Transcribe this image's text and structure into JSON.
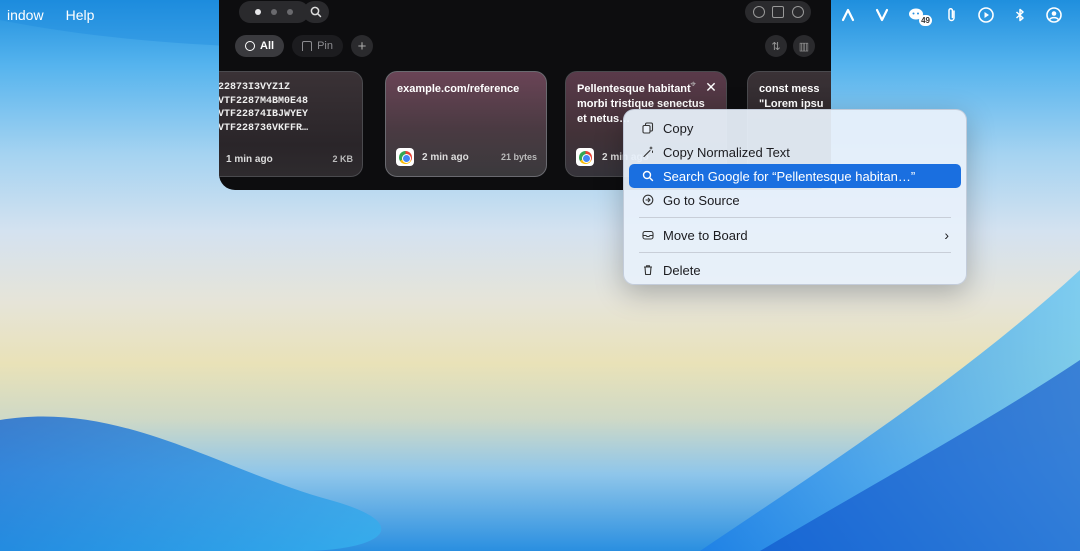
{
  "menubar": {
    "items": [
      "indow",
      "Help"
    ],
    "status_icons": [
      {
        "name": "arrow-a-icon",
        "glyph": "⋀"
      },
      {
        "name": "v-icon",
        "glyph": "V"
      },
      {
        "name": "wechat-icon",
        "badge": "49"
      },
      {
        "name": "paperclip-icon"
      },
      {
        "name": "play-icon"
      },
      {
        "name": "bluetooth-icon"
      },
      {
        "name": "user-icon"
      }
    ]
  },
  "panel": {
    "filters": {
      "all_label": "All",
      "pin_label": "Pin",
      "add_label": "+"
    },
    "cards": [
      {
        "text": "22873I3VYZ1Z\nVTF2287M4BM0E48\nVTF22874IBJWYEY\nVTF228736VKFFR…",
        "time": "1 min ago",
        "size": "2 KB"
      },
      {
        "text": "example.com/reference",
        "time": "2 min ago",
        "size": "21 bytes"
      },
      {
        "text": "Pellentesque habitant morbi tristique senectus et netus…",
        "time": "2 min ago",
        "close_glyph": "✕"
      },
      {
        "text": "const mess\n\"Lorem ipsu"
      }
    ]
  },
  "context_menu": {
    "items": [
      {
        "label": "Copy",
        "icon": "copy-icon"
      },
      {
        "label": "Copy Normalized Text",
        "icon": "wand-icon"
      },
      {
        "label": "Search Google for “Pellentesque habitan…”",
        "icon": "search-icon",
        "highlighted": true
      },
      {
        "label": "Go to Source",
        "icon": "source-icon"
      },
      {
        "label": "Move to Board",
        "icon": "board-icon",
        "submenu_glyph": "›"
      },
      {
        "label": "Delete",
        "icon": "trash-icon"
      }
    ]
  },
  "colors": {
    "highlight": "#1a6fe0",
    "panel_bg": "#0d0d0f"
  }
}
